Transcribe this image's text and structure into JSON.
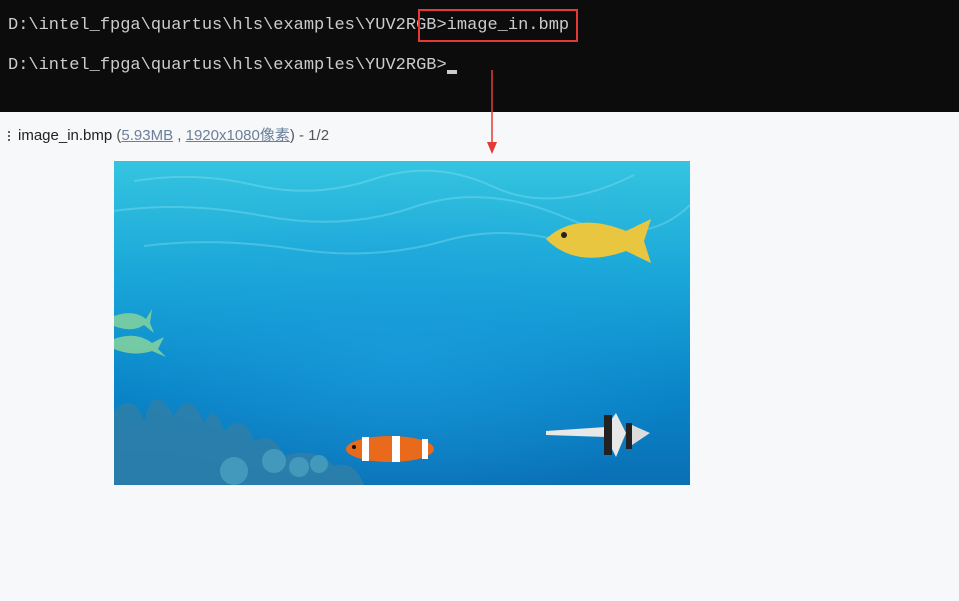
{
  "terminal": {
    "line1_prompt": "D:\\intel_fpga\\quartus\\hls\\examples\\YUV2RGB>",
    "line1_command": "image_in.bmp",
    "line2_prompt": "D:\\intel_fpga\\quartus\\hls\\examples\\YUV2RGB>"
  },
  "viewer": {
    "filename": "image_in.bmp",
    "open_paren": "(",
    "filesize": "5.93MB",
    "separator": ",",
    "dimensions": "1920x1080像素",
    "close_and_count": ") - 1/2"
  },
  "colors": {
    "annotation_red": "#e53935",
    "terminal_bg": "#0c0c0c",
    "link": "#6b7f99"
  },
  "icons": {
    "menu": "kebab-menu-icon",
    "arrow": "down-arrow-icon"
  }
}
